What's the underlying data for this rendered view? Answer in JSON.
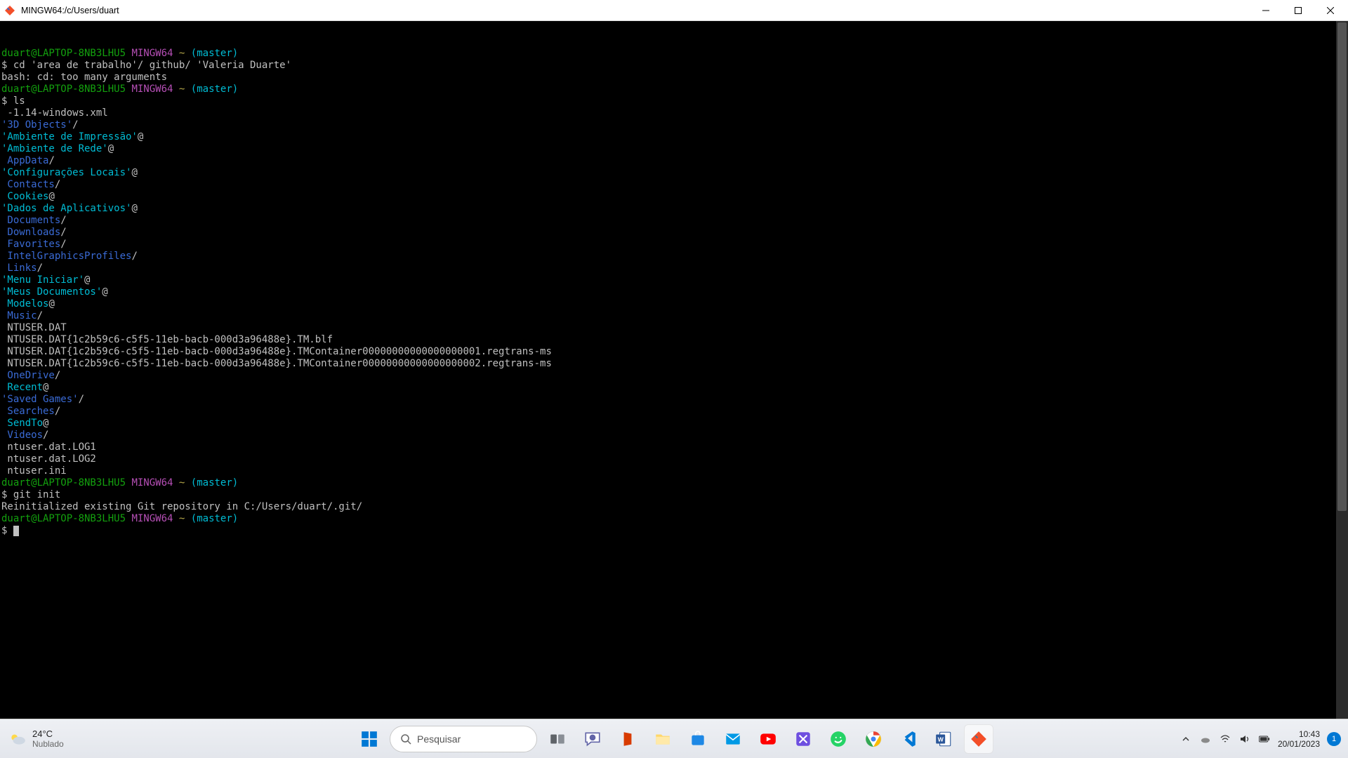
{
  "window": {
    "title": "MINGW64:/c/Users/duart"
  },
  "prompt": {
    "user_host": "duart@LAPTOP-8NB3LHU5",
    "env": "MINGW64",
    "path": "~",
    "ref": "(master)"
  },
  "blocks": [
    {
      "cmd": "cd 'area de trabalho'/ github/ 'Valeria Duarte'",
      "output": [
        {
          "text": "bash: cd: too many arguments",
          "cls": "fg-white"
        }
      ]
    },
    {
      "cmd": "ls",
      "output": [
        {
          "text": " -1.14-windows.xml",
          "cls": "fg-white"
        },
        {
          "segs": [
            {
              "t": "'3D Objects'",
              "c": "fg-blue"
            },
            {
              "t": "/",
              "c": "fg-white"
            }
          ]
        },
        {
          "segs": [
            {
              "t": "'Ambiente de Impressão'",
              "c": "fg-cyan"
            },
            {
              "t": "@",
              "c": "fg-white"
            }
          ]
        },
        {
          "segs": [
            {
              "t": "'Ambiente de Rede'",
              "c": "fg-cyan"
            },
            {
              "t": "@",
              "c": "fg-white"
            }
          ]
        },
        {
          "segs": [
            {
              "t": " AppData",
              "c": "fg-blue"
            },
            {
              "t": "/",
              "c": "fg-white"
            }
          ]
        },
        {
          "segs": [
            {
              "t": "'Configurações Locais'",
              "c": "fg-cyan"
            },
            {
              "t": "@",
              "c": "fg-white"
            }
          ]
        },
        {
          "segs": [
            {
              "t": " Contacts",
              "c": "fg-blue"
            },
            {
              "t": "/",
              "c": "fg-white"
            }
          ]
        },
        {
          "segs": [
            {
              "t": " Cookies",
              "c": "fg-cyan"
            },
            {
              "t": "@",
              "c": "fg-white"
            }
          ]
        },
        {
          "segs": [
            {
              "t": "'Dados de Aplicativos'",
              "c": "fg-cyan"
            },
            {
              "t": "@",
              "c": "fg-white"
            }
          ]
        },
        {
          "segs": [
            {
              "t": " Documents",
              "c": "fg-blue"
            },
            {
              "t": "/",
              "c": "fg-white"
            }
          ]
        },
        {
          "segs": [
            {
              "t": " Downloads",
              "c": "fg-blue"
            },
            {
              "t": "/",
              "c": "fg-white"
            }
          ]
        },
        {
          "segs": [
            {
              "t": " Favorites",
              "c": "fg-blue"
            },
            {
              "t": "/",
              "c": "fg-white"
            }
          ]
        },
        {
          "segs": [
            {
              "t": " IntelGraphicsProfiles",
              "c": "fg-blue"
            },
            {
              "t": "/",
              "c": "fg-white"
            }
          ]
        },
        {
          "segs": [
            {
              "t": " Links",
              "c": "fg-blue"
            },
            {
              "t": "/",
              "c": "fg-white"
            }
          ]
        },
        {
          "segs": [
            {
              "t": "'Menu Iniciar'",
              "c": "fg-cyan"
            },
            {
              "t": "@",
              "c": "fg-white"
            }
          ]
        },
        {
          "segs": [
            {
              "t": "'Meus Documentos'",
              "c": "fg-cyan"
            },
            {
              "t": "@",
              "c": "fg-white"
            }
          ]
        },
        {
          "segs": [
            {
              "t": " Modelos",
              "c": "fg-cyan"
            },
            {
              "t": "@",
              "c": "fg-white"
            }
          ]
        },
        {
          "segs": [
            {
              "t": " Music",
              "c": "fg-blue"
            },
            {
              "t": "/",
              "c": "fg-white"
            }
          ]
        },
        {
          "text": " NTUSER.DAT",
          "cls": "fg-white"
        },
        {
          "text": " NTUSER.DAT{1c2b59c6-c5f5-11eb-bacb-000d3a96488e}.TM.blf",
          "cls": "fg-white"
        },
        {
          "text": " NTUSER.DAT{1c2b59c6-c5f5-11eb-bacb-000d3a96488e}.TMContainer00000000000000000001.regtrans-ms",
          "cls": "fg-white"
        },
        {
          "text": " NTUSER.DAT{1c2b59c6-c5f5-11eb-bacb-000d3a96488e}.TMContainer00000000000000000002.regtrans-ms",
          "cls": "fg-white"
        },
        {
          "segs": [
            {
              "t": " OneDrive",
              "c": "fg-blue"
            },
            {
              "t": "/",
              "c": "fg-white"
            }
          ]
        },
        {
          "segs": [
            {
              "t": " Recent",
              "c": "fg-cyan"
            },
            {
              "t": "@",
              "c": "fg-white"
            }
          ]
        },
        {
          "segs": [
            {
              "t": "'Saved Games'",
              "c": "fg-blue"
            },
            {
              "t": "/",
              "c": "fg-white"
            }
          ]
        },
        {
          "segs": [
            {
              "t": " Searches",
              "c": "fg-blue"
            },
            {
              "t": "/",
              "c": "fg-white"
            }
          ]
        },
        {
          "segs": [
            {
              "t": " SendTo",
              "c": "fg-cyan"
            },
            {
              "t": "@",
              "c": "fg-white"
            }
          ]
        },
        {
          "segs": [
            {
              "t": " Videos",
              "c": "fg-blue"
            },
            {
              "t": "/",
              "c": "fg-white"
            }
          ]
        },
        {
          "text": " ntuser.dat.LOG1",
          "cls": "fg-white"
        },
        {
          "text": " ntuser.dat.LOG2",
          "cls": "fg-white"
        },
        {
          "text": " ntuser.ini",
          "cls": "fg-white"
        }
      ]
    },
    {
      "cmd": "git init",
      "output": [
        {
          "text": "Reinitialized existing Git repository in C:/Users/duart/.git/",
          "cls": "fg-white"
        }
      ]
    },
    {
      "cmd": "",
      "output": [],
      "cursor": true
    }
  ],
  "taskbar": {
    "weather": {
      "temp": "24°C",
      "desc": "Nublado"
    },
    "search_placeholder": "Pesquisar",
    "time": "10:43",
    "date": "20/01/2023",
    "notif_count": "1",
    "apps": [
      {
        "name": "start",
        "icon": "start"
      },
      {
        "name": "search",
        "icon": "search-pill"
      },
      {
        "name": "task-view",
        "icon": "taskview"
      },
      {
        "name": "chat",
        "icon": "chat"
      },
      {
        "name": "office",
        "icon": "office"
      },
      {
        "name": "file-explorer",
        "icon": "explorer"
      },
      {
        "name": "microsoft-store",
        "icon": "store"
      },
      {
        "name": "mail",
        "icon": "mail"
      },
      {
        "name": "youtube",
        "icon": "youtube"
      },
      {
        "name": "app-purple",
        "icon": "purple"
      },
      {
        "name": "whatsapp",
        "icon": "whatsapp"
      },
      {
        "name": "chrome",
        "icon": "chrome"
      },
      {
        "name": "vscode",
        "icon": "vscode"
      },
      {
        "name": "word",
        "icon": "word"
      },
      {
        "name": "git-bash",
        "icon": "gitbash",
        "active": true
      }
    ]
  }
}
